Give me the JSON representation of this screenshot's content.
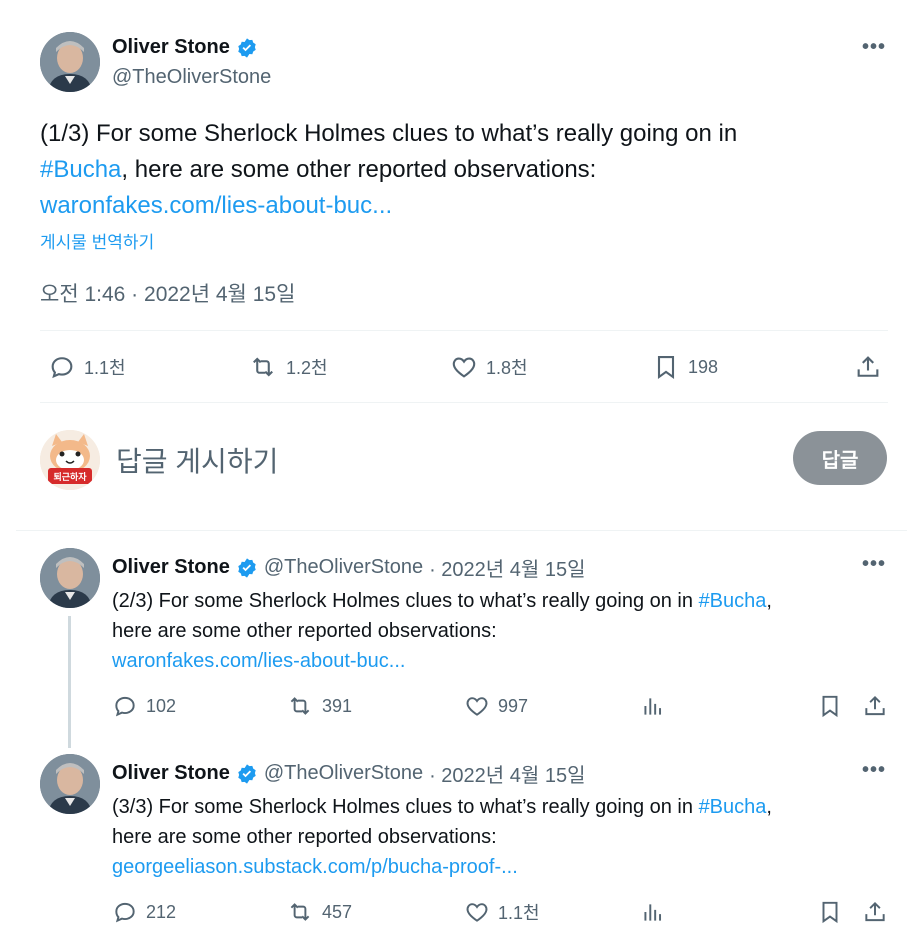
{
  "main_tweet": {
    "author_name": "Oliver Stone",
    "handle": "@TheOliverStone",
    "text_before": "(1/3) For some Sherlock Holmes clues to what’s really going on in",
    "hashtag": "#Bucha",
    "text_after": ", here are some other reported observations:",
    "link": "waronfakes.com/lies-about-buc...",
    "translate_label": "게시물 번역하기",
    "timestamp": "오전 1:46 · 2022년 4월 15일",
    "stats": {
      "replies": "1.1천",
      "retweets": "1.2천",
      "likes": "1.8천",
      "bookmarks": "198"
    }
  },
  "reply_composer": {
    "placeholder": "답글 게시하기",
    "button_label": "답글",
    "avatar_sticker_text": "퇴근하자"
  },
  "thread": [
    {
      "author_name": "Oliver Stone",
      "handle": "@TheOliverStone",
      "date": "· 2022년 4월 15일",
      "text_before": "(2/3) For some Sherlock Holmes clues to what’s really going on in",
      "hashtag": "#Bucha",
      "line2": "here are some other reported observations:",
      "link": "waronfakes.com/lies-about-buc...",
      "replies": "102",
      "retweets": "391",
      "likes": "997"
    },
    {
      "author_name": "Oliver Stone",
      "handle": "@TheOliverStone",
      "date": "· 2022년 4월 15일",
      "text_before": "(3/3) For some Sherlock Holmes clues to what’s really going on in",
      "hashtag": "#Bucha",
      "line2": "here are some other reported observations:",
      "link": "georgeeliason.substack.com/p/bucha-proof-...",
      "replies": "212",
      "retweets": "457",
      "likes": "1.1천"
    }
  ],
  "more_label": "•••",
  "colors": {
    "accent": "#1d9bf0",
    "muted": "#536471",
    "reply_button": "#8b9298"
  }
}
